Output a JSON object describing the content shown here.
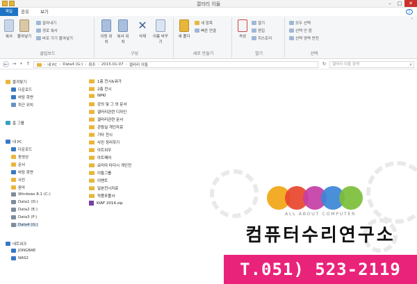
{
  "window": {
    "title": "갤러리 이들"
  },
  "tabs": [
    "파일",
    "홈",
    "공유",
    "보기"
  ],
  "ribbon": {
    "clipboard": {
      "copy": "복사",
      "paste": "붙여넣기",
      "cut": "잘라내기",
      "copy_path": "경로 복사",
      "paste_shortcut": "바로 가기 붙여넣기",
      "label": "클립보드"
    },
    "organize": {
      "move": "이동 위치",
      "copy_to": "복사 위치",
      "delete": "삭제",
      "rename": "이름 바꾸기",
      "label": "구성"
    },
    "new": {
      "new_folder": "새 폴더",
      "new_item": "새 항목",
      "easy_access": "빠른 연결",
      "label": "새로 만들기"
    },
    "open": {
      "properties": "속성",
      "open": "열기",
      "edit": "편집",
      "history": "히스토리",
      "label": "열기"
    },
    "select": {
      "select_all": "모두 선택",
      "select_none": "선택 안 함",
      "invert": "선택 영역 반전",
      "label": "선택"
    }
  },
  "address": {
    "crumbs": [
      "내 PC",
      "Data4 (G:)",
      "취주",
      "2015-01-07",
      "갤러리 이들"
    ],
    "search_placeholder": "갤러리 이들 검색"
  },
  "nav": {
    "items": [
      {
        "label": "즐겨찾기",
        "icon": "star-icon",
        "color": "#e8b63b"
      },
      {
        "label": "다운로드",
        "icon": "download-icon",
        "color": "#3a78c2"
      },
      {
        "label": "바탕 화면",
        "icon": "desktop-icon",
        "color": "#3a78c2"
      },
      {
        "label": "최근 위치",
        "icon": "recent-icon",
        "color": "#6b8fbf"
      },
      {
        "label": "홈 그룹",
        "icon": "homegroup-icon",
        "color": "#3aa0c2"
      },
      {
        "label": "내 PC",
        "icon": "pc-icon",
        "color": "#3a78c2"
      },
      {
        "label": "다운로드",
        "icon": "download-icon",
        "color": "#3a78c2"
      },
      {
        "label": "동영상",
        "icon": "video-icon",
        "color": "#e8b63b"
      },
      {
        "label": "문서",
        "icon": "document-icon",
        "color": "#e8b63b"
      },
      {
        "label": "바탕 화면",
        "icon": "desktop-icon",
        "color": "#3a78c2"
      },
      {
        "label": "사진",
        "icon": "picture-icon",
        "color": "#e8b63b"
      },
      {
        "label": "음악",
        "icon": "music-icon",
        "color": "#e8b63b"
      },
      {
        "label": "Windows 8.1 (C:)",
        "icon": "drive-icon",
        "color": "#7f8c99"
      },
      {
        "label": "Data1 (D:)",
        "icon": "drive-icon",
        "color": "#7f8c99"
      },
      {
        "label": "Data2 (E:)",
        "icon": "drive-icon",
        "color": "#7f8c99"
      },
      {
        "label": "Data3 (F:)",
        "icon": "drive-icon",
        "color": "#7f8c99"
      },
      {
        "label": "Data4 (G:)",
        "icon": "drive-icon",
        "color": "#7f8c99"
      },
      {
        "label": "네트워크",
        "icon": "network-icon",
        "color": "#3a78c2"
      },
      {
        "label": "JONGBAE",
        "icon": "computer-icon",
        "color": "#3a78c2"
      },
      {
        "label": "NAS2",
        "icon": "computer-icon",
        "color": "#3a78c2"
      }
    ]
  },
  "files": [
    {
      "name": "1층 전시&워가",
      "type": "folder"
    },
    {
      "name": "2층 전시",
      "type": "folder"
    },
    {
      "name": "NPKI",
      "type": "folder"
    },
    {
      "name": "강의 및 그 외 문서",
      "type": "folder"
    },
    {
      "name": "갤러리관련 디자인",
      "type": "folder"
    },
    {
      "name": "갤러리관련 문서",
      "type": "folder"
    },
    {
      "name": "관람실 개인자료",
      "type": "folder"
    },
    {
      "name": "기타 전시",
      "type": "folder"
    },
    {
      "name": "사진 정리하기",
      "type": "folder"
    },
    {
      "name": "아트위우",
      "type": "folder"
    },
    {
      "name": "아트페어",
      "type": "folder"
    },
    {
      "name": "요미아 타다시 개인전",
      "type": "folder"
    },
    {
      "name": "이들그룹",
      "type": "folder"
    },
    {
      "name": "이벤트",
      "type": "folder"
    },
    {
      "name": "일본전시자료",
      "type": "folder"
    },
    {
      "name": "작품포폴서",
      "type": "folder"
    },
    {
      "name": "KIAF 2014.zip",
      "type": "zip"
    }
  ],
  "ad": {
    "tagline": "ALL ABOUT COMPUTER",
    "company": "컴퓨터수리연구소",
    "phone": "T.051) 523-2119",
    "circle_colors": [
      "#f2a516",
      "#e8452c",
      "#c43ea6",
      "#3b86d6",
      "#7bbe3a"
    ],
    "bar_color": "#e9237a"
  }
}
